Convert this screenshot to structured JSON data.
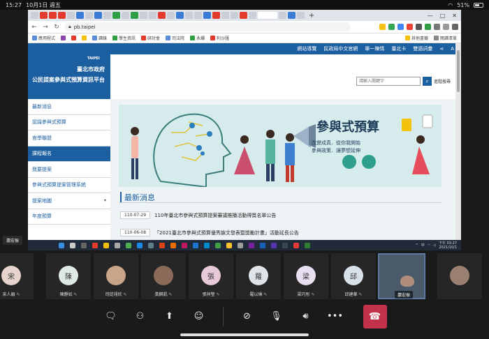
{
  "status_bar": {
    "time": "15:27",
    "date": "10月1日 週五",
    "battery": "51%"
  },
  "browser": {
    "url": "pb.taipei",
    "new_tab": "+"
  },
  "bookmarks": [
    "應用程式",
    "",
    "",
    "",
    "",
    "讀錄",
    "",
    "學生資訊",
    "",
    "研討會",
    "",
    "司法院",
    "",
    "",
    "",
    "",
    "永續",
    "",
    "利沙匯",
    "其他書籤",
    "閱讀清單"
  ],
  "site": {
    "topnav": [
      "網站導覽",
      "民政局中文官網",
      "單一陳情",
      "臺北卡",
      "雙語詞彙",
      "A"
    ],
    "title_line1": "臺北市政府",
    "title_line2": "公民提案參與式預算資訊平台",
    "logo_text": "TAIPEI",
    "search_placeholder": "請輸入關鍵字",
    "advanced_search": "進階搜尋",
    "sidebar": [
      "最新消息",
      "認識參與式預算",
      "官學聯盟",
      "課程報名",
      "我要提案",
      "參與式預算提案管理系統",
      "提案地圖",
      "年度預算"
    ],
    "sidebar_active_index": 3,
    "banner_title": "參與式預算",
    "banner_sub_line1": "改變成真．從你我開始",
    "banner_sub_line2": "參與政策．讓夢想延伸",
    "news_title": "最新消息",
    "news": [
      {
        "date": "110-07-29",
        "text": "110年臺北市參與式預算提案審議推播活動得獎名單公告"
      },
      {
        "date": "110-06-08",
        "text": "「2021臺北市參與式預算優秀論文發表暨獎勵計畫」活動延長公告"
      }
    ]
  },
  "taskbar": {
    "lang": "中",
    "clock_time": "下午 03:27",
    "clock_date": "2021/10/1"
  },
  "presenter_chip": "蕭宏振",
  "participants": [
    {
      "initial": "宋",
      "name": "宋人穎",
      "color": "#e8d3ce"
    },
    {
      "initial": "陳",
      "name": "陳靜如",
      "color": "#dfe9e4"
    },
    {
      "initial": "",
      "name": "司徒翊欣",
      "color": "#c9a489"
    },
    {
      "initial": "",
      "name": "黃麒凱",
      "color": "#8a6b5a"
    },
    {
      "initial": "張",
      "name": "張祥瑩",
      "color": "#e7c9d8"
    },
    {
      "initial": "羅",
      "name": "羅以琳",
      "color": "#dfe4e8"
    },
    {
      "initial": "梁",
      "name": "梁巧彤",
      "color": "#e8e0f0"
    },
    {
      "initial": "邱",
      "name": "邱建華",
      "color": "#d8e1ea"
    }
  ],
  "video_participant": "蕭宏振",
  "controls": [
    "chat",
    "participants",
    "share",
    "reactions",
    "camera-off",
    "mic-off",
    "speaker",
    "more",
    "hang-up"
  ]
}
